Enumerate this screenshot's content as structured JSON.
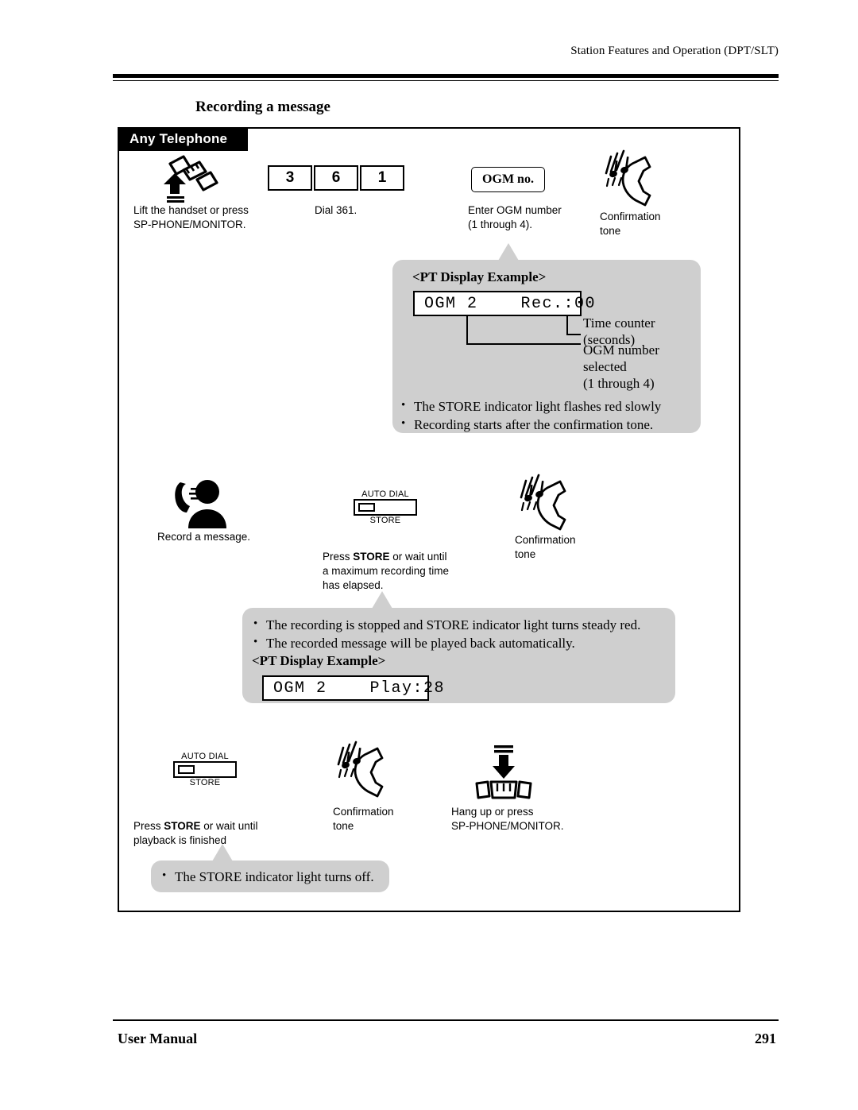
{
  "header": {
    "running_head": "Station Features and Operation (DPT/SLT)"
  },
  "section": {
    "title": "Recording a message",
    "tab_label": "Any Telephone"
  },
  "steps": {
    "row1": {
      "step1": {
        "icon": "lift-handset-icon",
        "caption": "Lift the handset or press\nSP-PHONE/MONITOR."
      },
      "step2": {
        "keys": [
          "3",
          "6",
          "1"
        ],
        "caption": "Dial 361."
      },
      "step3": {
        "box_label": "OGM no.",
        "caption": "Enter OGM number\n(1 through 4)."
      },
      "step4": {
        "icon": "confirmation-tone-icon",
        "caption": "Confirmation\ntone"
      }
    },
    "row2": {
      "step1": {
        "icon": "record-message-icon",
        "caption": "Record a message."
      },
      "step2": {
        "button_top": "AUTO DIAL",
        "button_bottom": "STORE",
        "caption_pre": "Press ",
        "caption_bold": "STORE",
        "caption_post": " or wait until\na maximum recording time\nhas elapsed."
      },
      "step3": {
        "icon": "confirmation-tone-icon",
        "caption": "Confirmation\ntone"
      }
    },
    "row3": {
      "step1": {
        "button_top": "AUTO DIAL",
        "button_bottom": "STORE",
        "caption_pre": "Press ",
        "caption_bold": "STORE",
        "caption_post": " or wait until\nplayback is finished"
      },
      "step2": {
        "icon": "confirmation-tone-icon",
        "caption": "Confirmation\ntone"
      },
      "step3": {
        "icon": "hang-up-icon",
        "caption": "Hang up or press\nSP-PHONE/MONITOR."
      }
    }
  },
  "callout1": {
    "title": "<PT Display Example>",
    "display": "OGM 2    Rec.:00",
    "leader_time": "Time counter\n(seconds)",
    "leader_ogm": "OGM  number\nselected\n(1 through 4)",
    "bullets": [
      "The STORE indicator light flashes red slowly",
      "Recording starts after the confirmation tone."
    ]
  },
  "callout2": {
    "bullets": [
      "The recording is stopped and STORE  indicator light turns steady red.",
      "The recorded message will be played back automatically."
    ],
    "title": "<PT Display Example>",
    "display": "OGM 2    Play:28"
  },
  "callout3": {
    "bullets": [
      "The STORE indicator light turns off."
    ]
  },
  "footer": {
    "left": "User Manual",
    "page": "291"
  },
  "colors": {
    "callout_gray": "#cfcfcf",
    "ink": "#000000",
    "tab_bg": "#000000",
    "tab_fg": "#ffffff"
  }
}
